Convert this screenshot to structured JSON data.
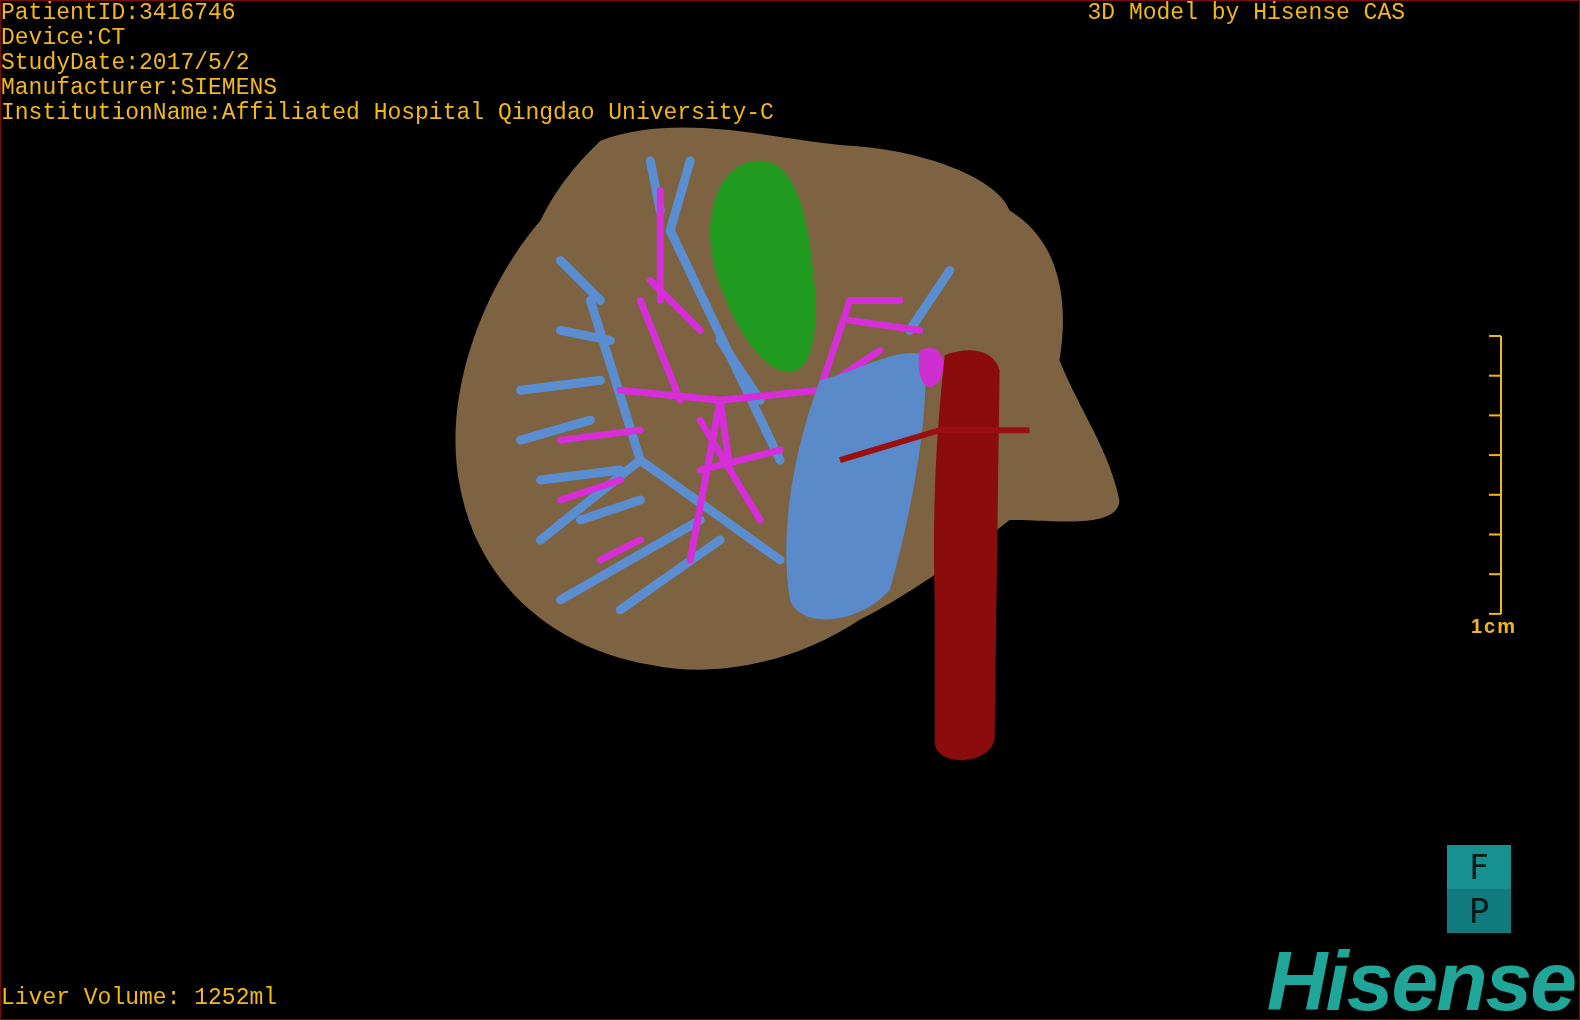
{
  "patient_info": [
    "PatientID:3416746",
    "Device:CT",
    "StudyDate:2017/5/2",
    "Manufacturer:SIEMENS",
    "InstitutionName:Affiliated Hospital Qingdao University-C"
  ],
  "title": "3D Model by Hisense CAS",
  "scale_bar": {
    "label": "1cm"
  },
  "orientation_cube": {
    "faces": [
      "F",
      "P"
    ]
  },
  "liver_volume": "Liver Volume: 1252ml",
  "logo": "Hisense"
}
